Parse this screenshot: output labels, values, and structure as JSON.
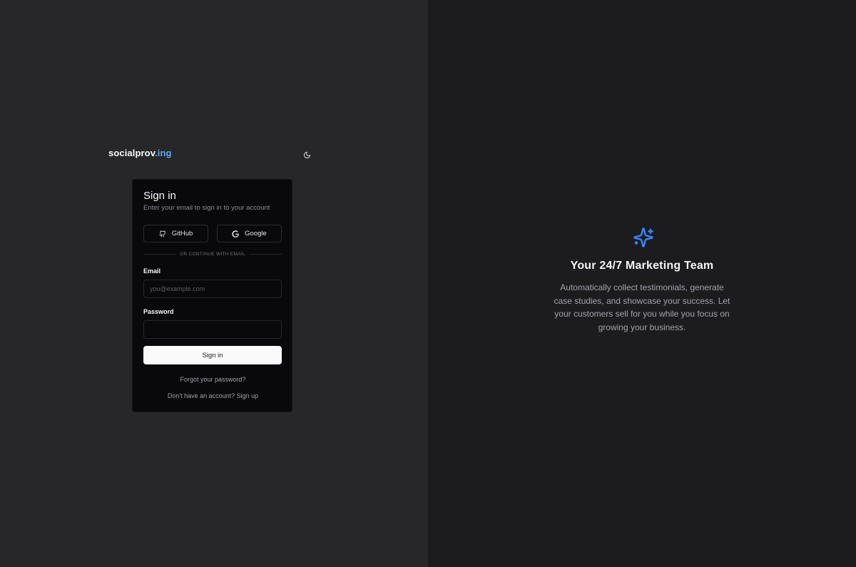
{
  "brand": {
    "name": "socialprov",
    "suffix": ".ing"
  },
  "icons": {
    "theme_toggle": "moon-icon",
    "github": "github-icon",
    "google": "google-icon",
    "hero": "sparkles-icon"
  },
  "colors": {
    "accent": "#60a5fa",
    "left_background": "#27272a",
    "right_background": "#1c1c1f",
    "card_background": "#09090b",
    "primary_button": "#fafafa"
  },
  "signin": {
    "title": "Sign in",
    "subtitle": "Enter your email to sign in to your account",
    "github_label": "GitHub",
    "google_label": "Google",
    "divider_text": "OR CONTINUE WITH EMAIL",
    "email_label": "Email",
    "email_placeholder": "you@example.com",
    "email_value": "",
    "password_label": "Password",
    "password_value": "",
    "submit_label": "Sign in",
    "forgot_link": "Forgot your password?",
    "signup_text": "Don't have an account? Sign up"
  },
  "hero": {
    "title": "Your 24/7 Marketing Team",
    "description": "Automatically collect testimonials, generate case studies, and showcase your success. Let your customers sell for you while you focus on growing your business."
  }
}
